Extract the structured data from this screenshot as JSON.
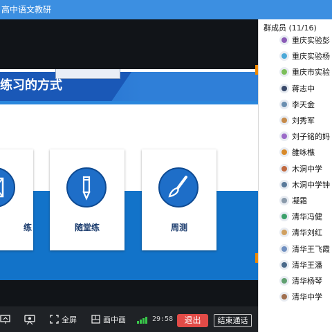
{
  "window": {
    "title": "高中语文教研"
  },
  "slide": {
    "title": "练习的方式",
    "cards": [
      {
        "label": "练",
        "icon": "exercise-book-icon"
      },
      {
        "label": "随堂练",
        "icon": "pen-icon"
      },
      {
        "label": "周测",
        "icon": "brush-icon"
      }
    ]
  },
  "toolbar": {
    "fullscreen_label": "全屏",
    "pip_label": "画中画",
    "timer": "29:58",
    "exit_label": "退出",
    "end_call_label": "结束通话",
    "signal_color": "#39c84a",
    "exit_color": "#e24b47"
  },
  "members": {
    "header": "群成员 (11/16)",
    "items": [
      {
        "name": "重庆实验彭"
      },
      {
        "name": "重庆实验杨"
      },
      {
        "name": "重庆市实验"
      },
      {
        "name": "蒋志中"
      },
      {
        "name": "李天金"
      },
      {
        "name": "刘秀军"
      },
      {
        "name": "刘子铭的妈"
      },
      {
        "name": "雒咏樵"
      },
      {
        "name": "木洞中学"
      },
      {
        "name": "木洞中学钟"
      },
      {
        "name": "凝霜"
      },
      {
        "name": "清华冯健"
      },
      {
        "name": "清华刘红"
      },
      {
        "name": "清华王飞霞"
      },
      {
        "name": "清华王潘"
      },
      {
        "name": "清华杨琴"
      },
      {
        "name": "清华中学"
      }
    ]
  },
  "colors": {
    "titlebar": "#3c8fe1",
    "slide_blue": "#1273c9",
    "accent_orange": "#f08a00"
  }
}
